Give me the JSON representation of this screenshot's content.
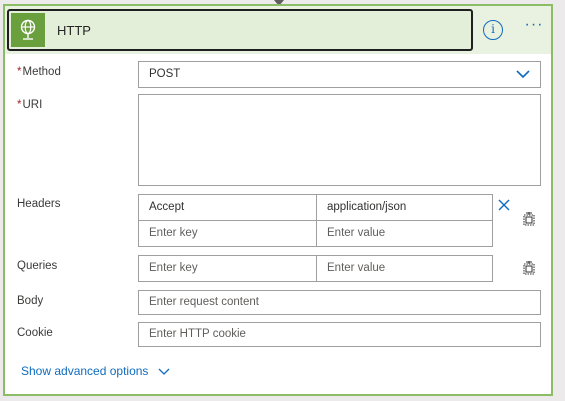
{
  "card": {
    "title": "HTTP",
    "info_icon": "info-icon",
    "more_icon": "more-icon",
    "info_glyph": "i",
    "more_glyph": "···"
  },
  "fields": {
    "method": {
      "label": "Method",
      "required": "*",
      "value": "POST"
    },
    "uri": {
      "label": "URI",
      "required": "*",
      "value": ""
    },
    "headers": {
      "label": "Headers",
      "rows": [
        {
          "key": "Accept",
          "value": "application/json"
        },
        {
          "key_placeholder": "Enter key",
          "value_placeholder": "Enter value"
        }
      ]
    },
    "queries": {
      "label": "Queries",
      "key_placeholder": "Enter key",
      "value_placeholder": "Enter value"
    },
    "body": {
      "label": "Body",
      "placeholder": "Enter request content"
    },
    "cookie": {
      "label": "Cookie",
      "placeholder": "Enter HTTP cookie"
    }
  },
  "advanced": {
    "label": "Show advanced options"
  },
  "colors": {
    "accent": "#0f6cbd",
    "header_bg": "#e9f1e0",
    "icon_tile": "#6a9f3e",
    "border_green": "#8cbd66",
    "required": "#a4262c"
  }
}
